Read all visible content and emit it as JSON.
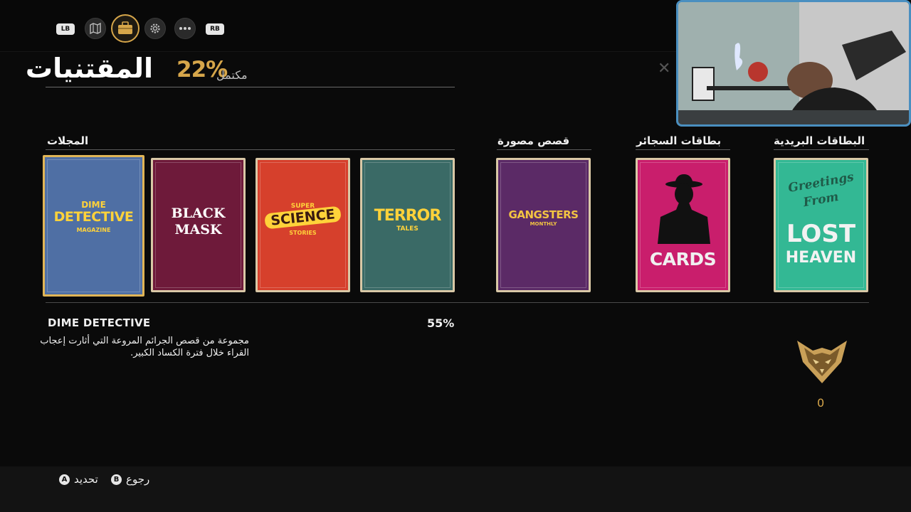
{
  "topnav": {
    "left_bumper": "LB",
    "right_bumper": "RB",
    "tabs": [
      {
        "icon": "map-icon"
      },
      {
        "icon": "briefcase-icon",
        "active": true
      },
      {
        "icon": "gear-icon"
      },
      {
        "icon": "more-icon"
      }
    ]
  },
  "header": {
    "title": "المقتنيات",
    "completion_percent": "22%",
    "completion_label": "مكتمل"
  },
  "categories": {
    "magazines": "المجلات",
    "comics": "قصص مصورة",
    "cigarette_cards": "بطاقات السجائر",
    "postcards": "البطاقات البريدية"
  },
  "cards": [
    {
      "id": "dime",
      "line1": "DIME",
      "line2": "DETECTIVE",
      "line3": "MAGAZINE",
      "color": "#4f6fa4",
      "selected": true
    },
    {
      "id": "black",
      "line1": "BLACK",
      "line2": "MASK",
      "color": "#6e1a3a"
    },
    {
      "id": "super",
      "line1": "SUPER",
      "line2": "SCIENCE",
      "line3": "STORIES",
      "color": "#d6402c"
    },
    {
      "id": "terror",
      "line1": "TERROR",
      "line2": "TALES",
      "color": "#3a6a66"
    },
    {
      "id": "gang",
      "line1": "GANGSTERS",
      "line2": "MONTHLY",
      "color": "#5b2a66"
    },
    {
      "id": "cards",
      "line1": "CARDS",
      "color": "#c91e6c"
    },
    {
      "id": "post",
      "line1": "Greetings",
      "line2": "From",
      "line3": "LOST",
      "line4": "HEAVEN",
      "color": "#33b894"
    }
  ],
  "details": {
    "name": "DIME DETECTIVE",
    "percent": "55%",
    "description": "مجموعة من قصص الجرائم المروعة التي أثارت إعجاب القراء خلال فترة الكساد الكبير."
  },
  "reward": {
    "icon": "fox-emblem-icon",
    "count": "0"
  },
  "footer": {
    "select_glyph": "A",
    "select_label": "تحديد",
    "back_glyph": "B",
    "back_label": "رجوع"
  },
  "colors": {
    "accent": "#d6a64a",
    "background": "#0a0a0a"
  }
}
